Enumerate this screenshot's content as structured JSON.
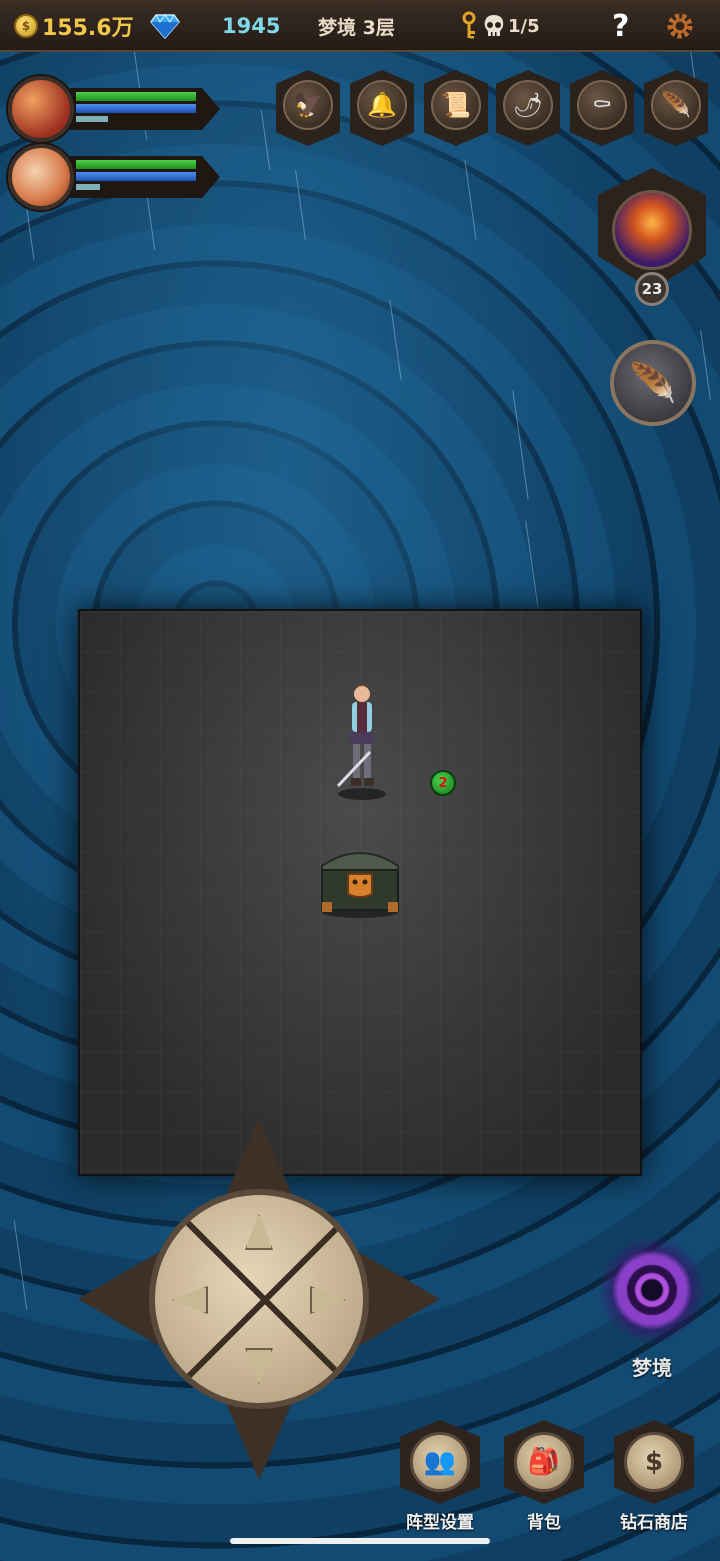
{
  "topbar": {
    "gold": "155.6万",
    "gems": "1945",
    "level": "梦境 3层",
    "kills": "1/5",
    "help": "?"
  },
  "heroes": [
    {
      "name": "hero-1",
      "hp": 1.0,
      "mp": 1.0,
      "xp": 0.25
    },
    {
      "name": "hero-2",
      "hp": 1.0,
      "mp": 1.0,
      "xp": 0.2
    }
  ],
  "item_slots": [
    "eagle-helmet-icon",
    "bell-icon",
    "scroll-icon",
    "chili-pepper-icon",
    "coffin-icon",
    "feather-icon"
  ],
  "boss": {
    "level": "23"
  },
  "map": {
    "marker_number": "2"
  },
  "portal": {
    "label": "梦境"
  },
  "bottom_buttons": [
    {
      "id": "formation",
      "label": "阵型设置",
      "icon": "team-icon"
    },
    {
      "id": "backpack",
      "label": "背包",
      "icon": "backpack-icon"
    },
    {
      "id": "diamond-shop",
      "label": "钻石商店",
      "icon": "dollar-icon"
    }
  ],
  "colors": {
    "gold": "#f2c84b",
    "gem": "#7fd8e8",
    "hp": "#2fbf2f",
    "mp": "#2e62d0"
  }
}
